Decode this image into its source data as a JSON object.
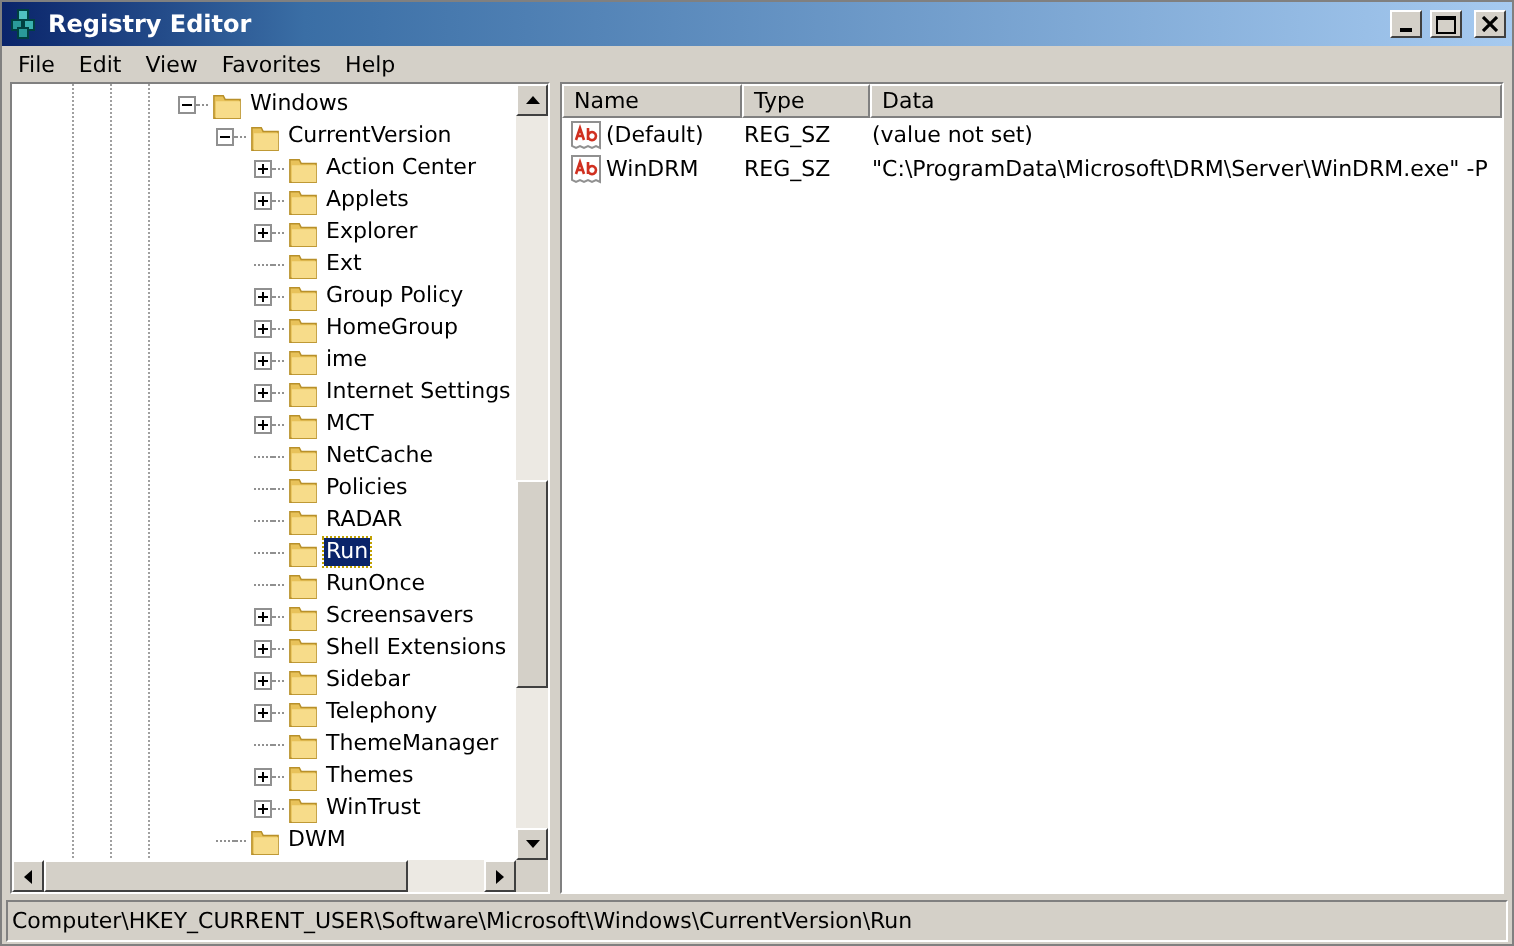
{
  "window": {
    "title": "Registry Editor"
  },
  "menu": [
    "File",
    "Edit",
    "View",
    "Favorites",
    "Help"
  ],
  "tree": [
    {
      "label": "Windows",
      "selected": false,
      "expanded": true,
      "children": [
        {
          "label": "CurrentVersion",
          "selected": false,
          "expanded": true,
          "children": [
            {
              "label": "Action Center",
              "selected": false,
              "expanded": false
            },
            {
              "label": "Applets",
              "selected": false,
              "expanded": false
            },
            {
              "label": "Explorer",
              "selected": false,
              "expanded": false
            },
            {
              "label": "Ext",
              "selected": false
            },
            {
              "label": "Group Policy",
              "selected": false,
              "expanded": false
            },
            {
              "label": "HomeGroup",
              "selected": false,
              "expanded": false
            },
            {
              "label": "ime",
              "selected": false,
              "expanded": false
            },
            {
              "label": "Internet Settings",
              "selected": false,
              "expanded": false
            },
            {
              "label": "MCT",
              "selected": false,
              "expanded": false
            },
            {
              "label": "NetCache",
              "selected": false
            },
            {
              "label": "Policies",
              "selected": false
            },
            {
              "label": "RADAR",
              "selected": false
            },
            {
              "label": "Run",
              "selected": true
            },
            {
              "label": "RunOnce",
              "selected": false
            },
            {
              "label": "Screensavers",
              "selected": false,
              "expanded": false
            },
            {
              "label": "Shell Extensions",
              "selected": false,
              "expanded": false
            },
            {
              "label": "Sidebar",
              "selected": false,
              "expanded": false
            },
            {
              "label": "Telephony",
              "selected": false,
              "expanded": false
            },
            {
              "label": "ThemeManager",
              "selected": false
            },
            {
              "label": "Themes",
              "selected": false,
              "expanded": false
            },
            {
              "label": "WinTrust",
              "selected": false,
              "expanded": false
            }
          ]
        },
        {
          "label": "DWM",
          "selected": false
        }
      ]
    }
  ],
  "table": {
    "columns": [
      "Name",
      "Type",
      "Data"
    ],
    "rows": [
      {
        "name": "(Default)",
        "type": "REG_SZ",
        "data": "(value not set)"
      },
      {
        "name": "WinDRM",
        "type": "REG_SZ",
        "data": "\"C:\\ProgramData\\Microsoft\\DRM\\Server\\WinDRM.exe\" -P"
      }
    ]
  },
  "status_bar": "Computer\\HKEY_CURRENT_USER\\Software\\Microsoft\\Windows\\CurrentVersion\\Run"
}
